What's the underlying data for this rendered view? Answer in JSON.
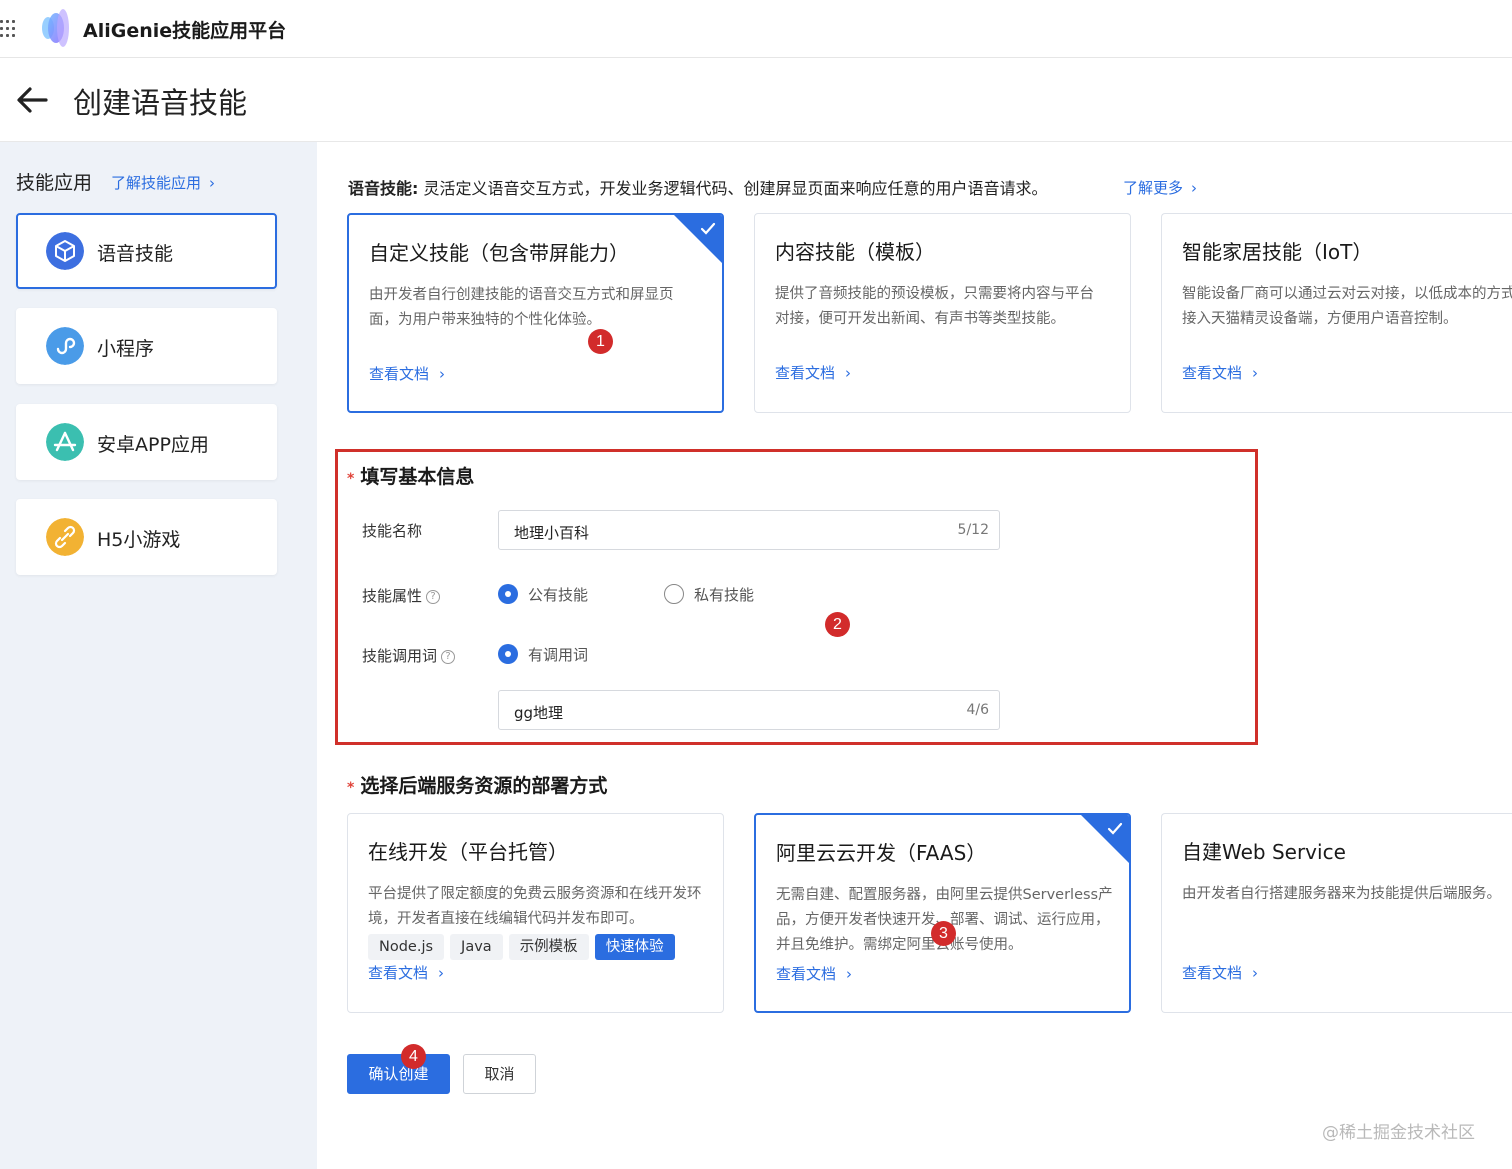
{
  "topbar": {
    "brand": "AliGenie技能应用平台",
    "icons": [
      "apps-grid-icon",
      "aligenie-logo-icon"
    ]
  },
  "header": {
    "title": "创建语音技能",
    "back_icon": "arrow-left-icon"
  },
  "sidebar": {
    "heading": "技能应用",
    "link": "了解技能应用",
    "items": [
      {
        "label": "语音技能",
        "icon": "cube-icon",
        "color": "#3d6fe0",
        "active": true
      },
      {
        "label": "小程序",
        "icon": "miniapp-icon",
        "color": "#4a9be8",
        "active": false
      },
      {
        "label": "安卓APP应用",
        "icon": "app-store-icon",
        "color": "#3bbfb0",
        "active": false
      },
      {
        "label": "H5小游戏",
        "icon": "link-icon",
        "color": "#f2b233",
        "active": false
      }
    ]
  },
  "intro": {
    "label": "语音技能:",
    "text": " 灵活定义语音交互方式，开发业务逻辑代码、创建屏显页面来响应任意的用户语音请求。",
    "link": "了解更多"
  },
  "skill_types": [
    {
      "title": "自定义技能（包含带屏能力）",
      "desc": "由开发者自行创建技能的语音交互方式和屏显页面，为用户带来独特的个性化体验。",
      "link": "查看文档",
      "selected": true
    },
    {
      "title": "内容技能（模板）",
      "desc": "提供了音频技能的预设模板，只需要将内容与平台对接，便可开发出新闻、有声书等类型技能。",
      "link": "查看文档",
      "selected": false
    },
    {
      "title": "智能家居技能（IoT）",
      "desc": "智能设备厂商可以通过云对云对接，以低成本的方式快速接入天猫精灵设备端，方便用户语音控制。",
      "link": "查看文档",
      "selected": false
    }
  ],
  "basic_info": {
    "title": "填写基本信息",
    "name_label": "技能名称",
    "name_value": "地理小百科",
    "name_count": "5/12",
    "attr_label": "技能属性",
    "attr_public": "公有技能",
    "attr_private": "私有技能",
    "invoke_label": "技能调用词",
    "invoke_option": "有调用词",
    "invoke_value": "gg地理",
    "invoke_count": "4/6"
  },
  "deploy": {
    "title": "选择后端服务资源的部署方式",
    "cards": [
      {
        "title": "在线开发（平台托管）",
        "desc": "平台提供了限定额度的免费云服务资源和在线开发环境，开发者直接在线编辑代码并发布即可。",
        "link": "查看文档",
        "selected": false,
        "tags": [
          "Node.js",
          "Java",
          "示例模板",
          "快速体验"
        ]
      },
      {
        "title": "阿里云云开发（FAAS）",
        "desc": "无需自建、配置服务器，由阿里云提供Serverless产品，方便开发者快速开发、部署、调试、运行应用，并且免维护。需绑定阿里云账号使用。",
        "link": "查看文档",
        "selected": true
      },
      {
        "title": "自建Web Service",
        "desc": "由开发者自行搭建服务器来为技能提供后端服务。",
        "link": "查看文档",
        "selected": false
      }
    ]
  },
  "buttons": {
    "confirm": "确认创建",
    "cancel": "取消"
  },
  "annotations": [
    "1",
    "2",
    "3",
    "4"
  ],
  "watermark": "@稀土掘金技术社区",
  "colors": {
    "accent": "#2b6de0",
    "highlight_box": "#d0302a",
    "badge": "#d22b2b"
  }
}
